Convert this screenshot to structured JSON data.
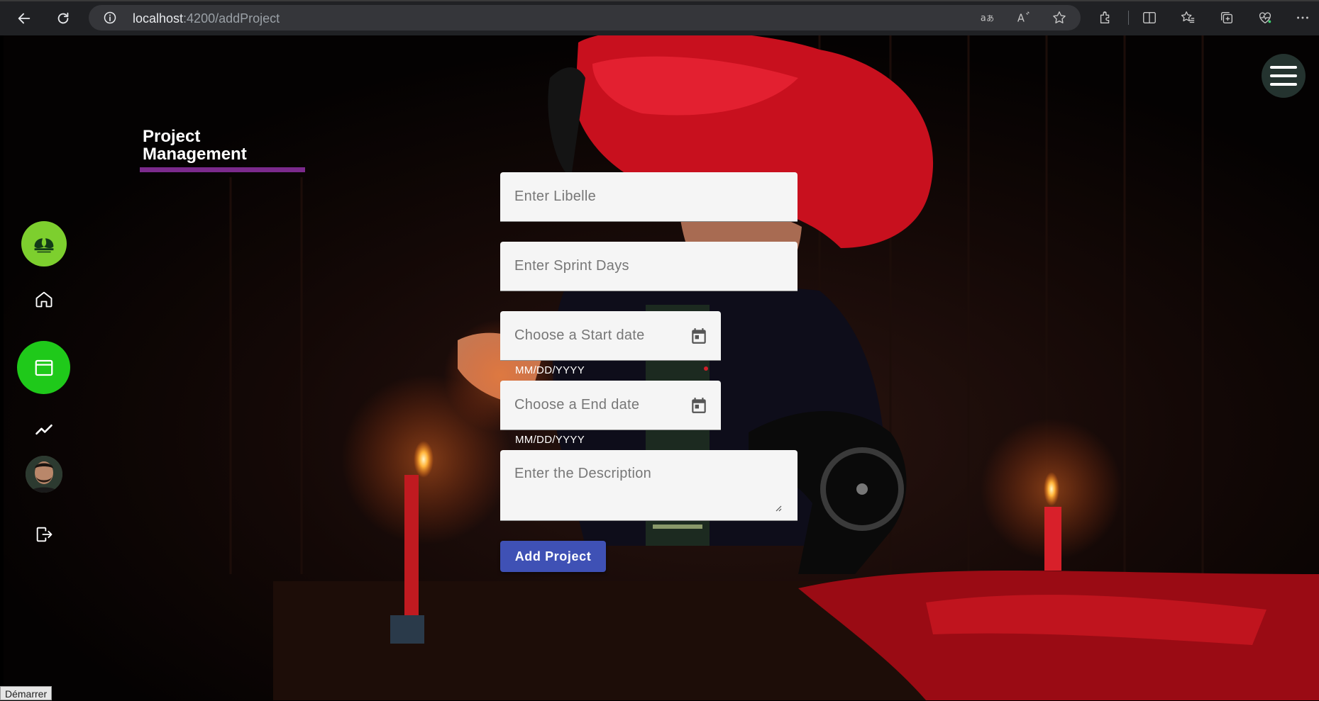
{
  "browser": {
    "url_host": "localhost",
    "url_path": ":4200/addProject"
  },
  "brand": {
    "title": "Project\nManagement",
    "accent_color": "#7b2a8c"
  },
  "sidebar": {
    "items": [
      {
        "name": "logo",
        "icon": "leaf-logo-icon"
      },
      {
        "name": "home",
        "icon": "home-icon"
      },
      {
        "name": "projects",
        "icon": "calendar-window-icon",
        "active": true,
        "active_color": "#1fc91a"
      },
      {
        "name": "stats",
        "icon": "trending-up-icon"
      },
      {
        "name": "profile",
        "icon": "avatar"
      },
      {
        "name": "logout",
        "icon": "logout-icon"
      }
    ]
  },
  "form": {
    "libelle_placeholder": "Enter Libelle",
    "sprint_placeholder": "Enter Sprint Days",
    "start_placeholder": "Choose a Start date",
    "start_hint": "MM/DD/YYYY",
    "end_placeholder": "Choose a End date",
    "end_hint": "MM/DD/YYYY",
    "description_placeholder": "Enter the Description",
    "submit_label": "Add Project",
    "submit_color": "#3f51b5"
  },
  "status_tag": "Démarrer"
}
